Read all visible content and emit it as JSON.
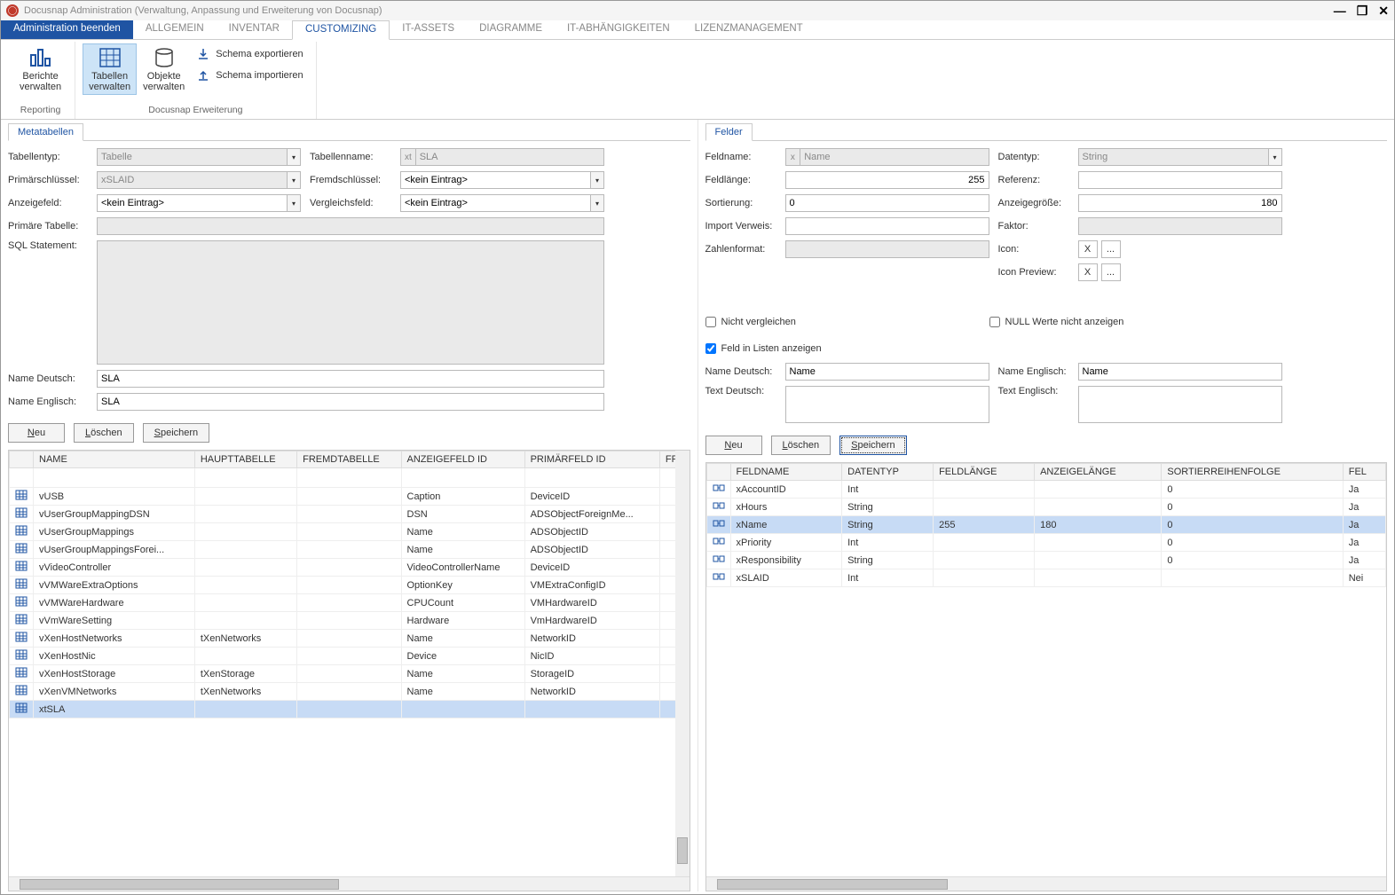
{
  "window": {
    "title": "Docusnap Administration (Verwaltung, Anpassung und Erweiterung von Docusnap)"
  },
  "menubar": {
    "primary": "Administration beenden",
    "items": [
      "ALLGEMEIN",
      "INVENTAR",
      "CUSTOMIZING",
      "IT-ASSETS",
      "DIAGRAMME",
      "IT-ABHÄNGIGKEITEN",
      "LIZENZMANAGEMENT"
    ],
    "active_index": 2
  },
  "ribbon": {
    "reporting": {
      "berichte": "Berichte verwalten",
      "caption": "Reporting"
    },
    "erweiterung": {
      "tabellen": "Tabellen verwalten",
      "objekte": "Objekte verwalten",
      "export": "Schema exportieren",
      "import": "Schema importieren",
      "caption": "Docusnap Erweiterung"
    }
  },
  "left": {
    "tab": "Metatabellen",
    "labels": {
      "tabellentyp": "Tabellentyp:",
      "tabellenname": "Tabellenname:",
      "primarschl": "Primärschlüssel:",
      "fremdschl": "Fremdschlüssel:",
      "anzeigefeld": "Anzeigefeld:",
      "vergleichsfeld": "Vergleichsfeld:",
      "primtabelle": "Primäre Tabelle:",
      "sql": "SQL Statement:",
      "namede": "Name Deutsch:",
      "nameen": "Name Englisch:"
    },
    "values": {
      "tabellentyp": "Tabelle",
      "tabellenname_prefix": "xt",
      "tabellenname": "SLA",
      "primarschl": "xSLAID",
      "fremdschl": "<kein Eintrag>",
      "anzeigefeld": "<kein Eintrag>",
      "vergleichsfeld": "<kein Eintrag>",
      "primtabelle": "",
      "sql": "",
      "namede": "SLA",
      "nameen": "SLA"
    },
    "buttons": {
      "neu": "Neu",
      "loeschen": "Löschen",
      "speichern": "Speichern"
    },
    "grid": {
      "cols": [
        "NAME",
        "HAUPTTABELLE",
        "FREMDTABELLE",
        "ANZEIGEFELD ID",
        "PRIMÄRFELD ID",
        "FR"
      ],
      "rows": [
        {
          "name": "vUSB",
          "haupt": "",
          "fremd": "",
          "anz": "Caption",
          "prim": "DeviceID"
        },
        {
          "name": "vUserGroupMappingDSN",
          "haupt": "",
          "fremd": "",
          "anz": "DSN",
          "prim": "ADSObjectForeignMe..."
        },
        {
          "name": "vUserGroupMappings",
          "haupt": "",
          "fremd": "",
          "anz": "Name",
          "prim": "ADSObjectID"
        },
        {
          "name": "vUserGroupMappingsForei...",
          "haupt": "",
          "fremd": "",
          "anz": "Name",
          "prim": "ADSObjectID"
        },
        {
          "name": "vVideoController",
          "haupt": "",
          "fremd": "",
          "anz": "VideoControllerName",
          "prim": "DeviceID"
        },
        {
          "name": "vVMWareExtraOptions",
          "haupt": "",
          "fremd": "",
          "anz": "OptionKey",
          "prim": "VMExtraConfigID"
        },
        {
          "name": "vVMWareHardware",
          "haupt": "",
          "fremd": "",
          "anz": "CPUCount",
          "prim": "VMHardwareID"
        },
        {
          "name": "vVmWareSetting",
          "haupt": "",
          "fremd": "",
          "anz": "Hardware",
          "prim": "VmHardwareID"
        },
        {
          "name": "vXenHostNetworks",
          "haupt": "tXenNetworks",
          "fremd": "",
          "anz": "Name",
          "prim": "NetworkID"
        },
        {
          "name": "vXenHostNic",
          "haupt": "",
          "fremd": "",
          "anz": "Device",
          "prim": "NicID"
        },
        {
          "name": "vXenHostStorage",
          "haupt": "tXenStorage",
          "fremd": "",
          "anz": "Name",
          "prim": "StorageID"
        },
        {
          "name": "vXenVMNetworks",
          "haupt": "tXenNetworks",
          "fremd": "",
          "anz": "Name",
          "prim": "NetworkID"
        },
        {
          "name": "xtSLA",
          "haupt": "",
          "fremd": "",
          "anz": "",
          "prim": "",
          "selected": true
        }
      ]
    }
  },
  "right": {
    "tab": "Felder",
    "labels": {
      "feldname": "Feldname:",
      "datentyp": "Datentyp:",
      "feldlaenge": "Feldlänge:",
      "referenz": "Referenz:",
      "sortierung": "Sortierung:",
      "anzeigegroesse": "Anzeigegröße:",
      "importverweis": "Import Verweis:",
      "faktor": "Faktor:",
      "zahlenformat": "Zahlenformat:",
      "icon": "Icon:",
      "iconpreview": "Icon Preview:",
      "nichtvergleichen": "Nicht vergleichen",
      "nullwerte": "NULL Werte nicht anzeigen",
      "feldlisten": "Feld in Listen anzeigen",
      "namede": "Name Deutsch:",
      "nameen": "Name Englisch:",
      "textde": "Text Deutsch:",
      "texten": "Text Englisch:"
    },
    "values": {
      "feldname_prefix": "x",
      "feldname": "Name",
      "datentyp": "String",
      "feldlaenge": "255",
      "referenz": "",
      "sortierung": "0",
      "anzeigegroesse": "180",
      "importverweis": "",
      "faktor": "",
      "zahlenformat": "",
      "nichtvergleichen": false,
      "nullwerte": false,
      "feldlisten": true,
      "namede": "Name",
      "nameen": "Name",
      "textde": "",
      "texten": "",
      "icon_x": "X",
      "icon_dots": "..."
    },
    "buttons": {
      "neu": "Neu",
      "loeschen": "Löschen",
      "speichern": "Speichern"
    },
    "grid": {
      "cols": [
        "FELDNAME",
        "DATENTYP",
        "FELDLÄNGE",
        "ANZEIGELÄNGE",
        "SORTIERREIHENFOLGE",
        "FEL"
      ],
      "rows": [
        {
          "feld": "xAccountID",
          "dt": "Int",
          "len": "",
          "anz": "",
          "sort": "0",
          "f": "Ja"
        },
        {
          "feld": "xHours",
          "dt": "String",
          "len": "",
          "anz": "",
          "sort": "0",
          "f": "Ja"
        },
        {
          "feld": "xName",
          "dt": "String",
          "len": "255",
          "anz": "180",
          "sort": "0",
          "f": "Ja",
          "selected": true
        },
        {
          "feld": "xPriority",
          "dt": "Int",
          "len": "",
          "anz": "",
          "sort": "0",
          "f": "Ja"
        },
        {
          "feld": "xResponsibility",
          "dt": "String",
          "len": "",
          "anz": "",
          "sort": "0",
          "f": "Ja"
        },
        {
          "feld": "xSLAID",
          "dt": "Int",
          "len": "",
          "anz": "",
          "sort": "",
          "f": "Nei"
        }
      ]
    }
  }
}
